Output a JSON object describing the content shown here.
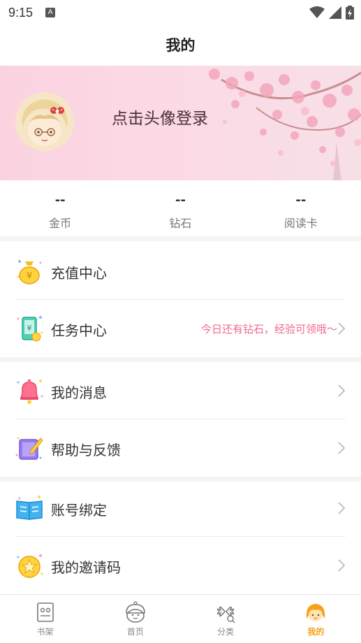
{
  "status_bar": {
    "time": "9:15",
    "notification_letter": "A"
  },
  "header": {
    "title": "我的"
  },
  "profile": {
    "login_prompt": "点击头像登录"
  },
  "stats": [
    {
      "value": "--",
      "label": "金币"
    },
    {
      "value": "--",
      "label": "钻石"
    },
    {
      "value": "--",
      "label": "阅读卡"
    }
  ],
  "menu": {
    "recharge": {
      "label": "充值中心",
      "icon": "money-bag-icon"
    },
    "tasks": {
      "label": "任务中心",
      "hint": "今日还有钻石，经验可领哦～",
      "icon": "task-phone-icon"
    },
    "messages": {
      "label": "我的消息",
      "icon": "bell-icon"
    },
    "help": {
      "label": "帮助与反馈",
      "icon": "pencil-note-icon"
    },
    "account": {
      "label": "账号绑定",
      "icon": "book-icon"
    },
    "invite": {
      "label": "我的邀请码",
      "icon": "star-coin-icon"
    }
  },
  "bottom_nav": [
    {
      "label": "书架",
      "icon": "bookshelf-icon"
    },
    {
      "label": "首页",
      "icon": "home-face-icon"
    },
    {
      "label": "分类",
      "icon": "category-clover-icon"
    },
    {
      "label": "我的",
      "icon": "profile-girl-icon",
      "active": true
    }
  ],
  "colors": {
    "accent": "#f5a21b",
    "hint": "#f06a8e",
    "banner": "#fbd3e0"
  }
}
